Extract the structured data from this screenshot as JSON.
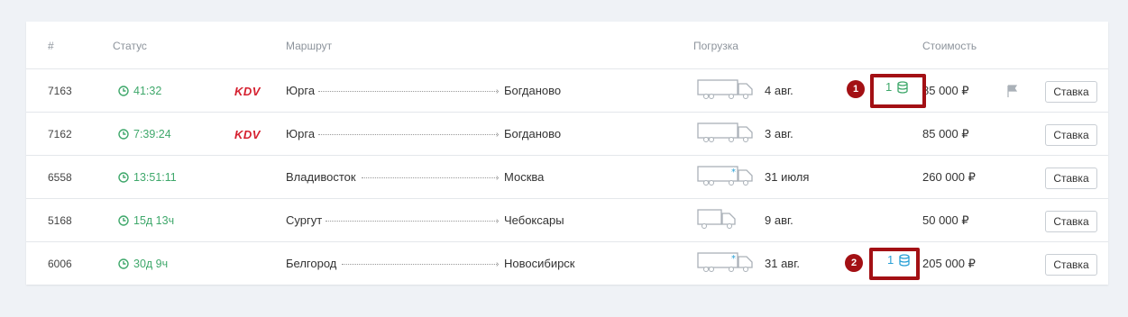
{
  "headers": {
    "num": "#",
    "status": "Статус",
    "route": "Маршрут",
    "loading": "Погрузка",
    "cost": "Стоимость"
  },
  "bid_button_label": "Ставка",
  "rows": [
    {
      "id": "7163",
      "timer": "41:32",
      "logo": "KDV",
      "from": "Юрга",
      "to": "Богданово",
      "truck": "truck-icon",
      "date": "4 авг.",
      "bids": "1",
      "price": "85 000 ₽",
      "flagged": true
    },
    {
      "id": "7162",
      "timer": "7:39:24",
      "logo": "KDV",
      "from": "Юрга",
      "to": "Богданово",
      "truck": "truck-icon",
      "date": "3 авг.",
      "bids": "",
      "price": "85 000 ₽",
      "flagged": false
    },
    {
      "id": "6558",
      "timer": "13:51:11",
      "logo": "",
      "from": "Владивосток",
      "to": "Москва",
      "truck": "refrigerator-truck-icon",
      "date": "31 июля",
      "bids": "",
      "price": "260 000 ₽",
      "flagged": false
    },
    {
      "id": "5168",
      "timer": "15д 13ч",
      "logo": "",
      "from": "Сургут",
      "to": "Чебоксары",
      "truck": "small-truck-icon",
      "date": "9 авг.",
      "bids": "",
      "price": "50 000 ₽",
      "flagged": false
    },
    {
      "id": "6006",
      "timer": "30д 9ч",
      "logo": "",
      "from": "Белгород",
      "to": "Новосибирск",
      "truck": "refrigerator-truck-icon",
      "date": "31 авг.",
      "bids": "1",
      "price": "205 000 ₽",
      "flagged": false
    }
  ],
  "annotations": [
    {
      "label": "1"
    },
    {
      "label": "2"
    }
  ],
  "colors": {
    "timer": "#3fa86b",
    "bids_green": "#3fa86b",
    "bids_blue": "#2aa0d6",
    "logo": "#d5202f",
    "marker": "#a31014"
  }
}
